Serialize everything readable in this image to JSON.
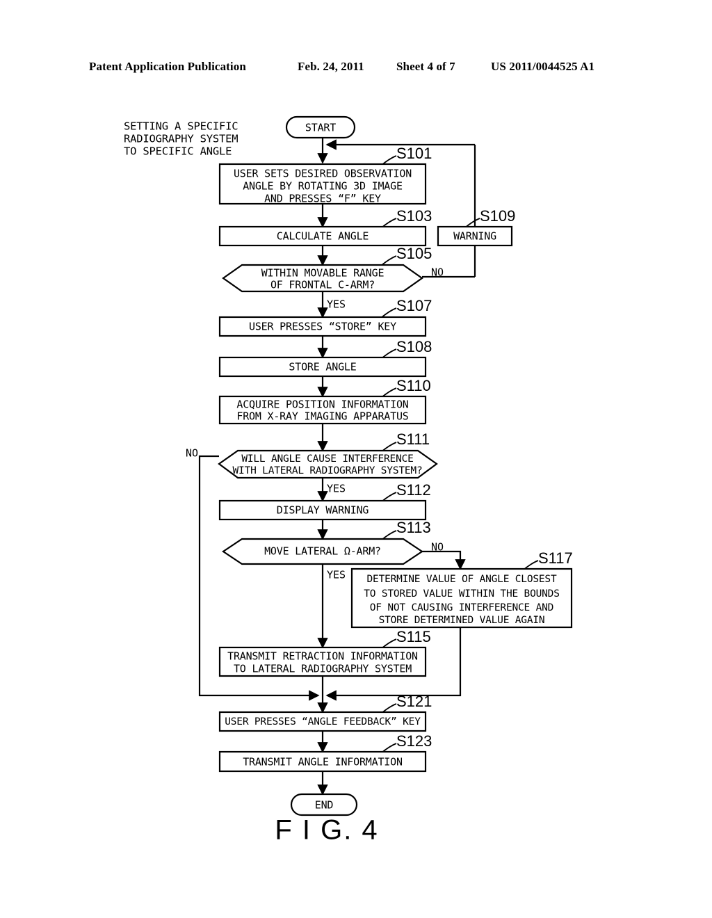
{
  "header": {
    "publication": "Patent Application Publication",
    "date": "Feb. 24, 2011",
    "sheet": "Sheet 4 of 7",
    "number": "US 2011/0044525 A1"
  },
  "figure": {
    "caption": "F I G. 4",
    "side_note": {
      "lines": [
        "SETTING A SPECIFIC",
        "RADIOGRAPHY SYSTEM",
        "TO SPECIFIC ANGLE"
      ]
    },
    "terminators": {
      "start": "START",
      "end": "END"
    },
    "branch_labels": {
      "s105_no": "NO",
      "s105_yes": "YES",
      "s111_no": "NO",
      "s111_yes": "YES",
      "s113_no": "NO",
      "s113_yes": "YES"
    },
    "nodes": [
      {
        "id": "S101",
        "tag": "S101",
        "type": "process",
        "lines": [
          "USER SETS DESIRED OBSERVATION",
          "ANGLE BY ROTATING 3D IMAGE",
          "AND PRESSES “F” KEY"
        ]
      },
      {
        "id": "S103",
        "tag": "S103",
        "type": "process",
        "lines": [
          "CALCULATE ANGLE"
        ]
      },
      {
        "id": "S109",
        "tag": "S109",
        "type": "process",
        "lines": [
          "WARNING"
        ]
      },
      {
        "id": "S105",
        "tag": "S105",
        "type": "decision",
        "lines": [
          "WITHIN MOVABLE RANGE",
          "OF FRONTAL C-ARM?"
        ]
      },
      {
        "id": "S107",
        "tag": "S107",
        "type": "process",
        "lines": [
          "USER PRESSES “STORE” KEY"
        ]
      },
      {
        "id": "S108",
        "tag": "S108",
        "type": "process",
        "lines": [
          "STORE ANGLE"
        ]
      },
      {
        "id": "S110",
        "tag": "S110",
        "type": "process",
        "lines": [
          "ACQUIRE POSITION INFORMATION",
          "FROM X-RAY IMAGING APPARATUS"
        ]
      },
      {
        "id": "S111",
        "tag": "S111",
        "type": "decision",
        "lines": [
          "WILL ANGLE CAUSE INTERFERENCE",
          "WITH LATERAL RADIOGRAPHY SYSTEM?"
        ]
      },
      {
        "id": "S112",
        "tag": "S112",
        "type": "process",
        "lines": [
          "DISPLAY WARNING"
        ]
      },
      {
        "id": "S113",
        "tag": "S113",
        "type": "decision",
        "lines": [
          "MOVE LATERAL Ω-ARM?"
        ]
      },
      {
        "id": "S117",
        "tag": "S117",
        "type": "process",
        "lines": [
          "DETERMINE VALUE OF ANGLE CLOSEST",
          "TO STORED VALUE WITHIN THE BOUNDS",
          "OF NOT CAUSING INTERFERENCE AND",
          "STORE DETERMINED VALUE AGAIN"
        ]
      },
      {
        "id": "S115",
        "tag": "S115",
        "type": "process",
        "lines": [
          "TRANSMIT RETRACTION INFORMATION",
          "TO LATERAL RADIOGRAPHY SYSTEM"
        ]
      },
      {
        "id": "S121",
        "tag": "S121",
        "type": "process",
        "lines": [
          "USER PRESSES “ANGLE FEEDBACK” KEY"
        ]
      },
      {
        "id": "S123",
        "tag": "S123",
        "type": "process",
        "lines": [
          "TRANSMIT ANGLE INFORMATION"
        ]
      }
    ]
  }
}
